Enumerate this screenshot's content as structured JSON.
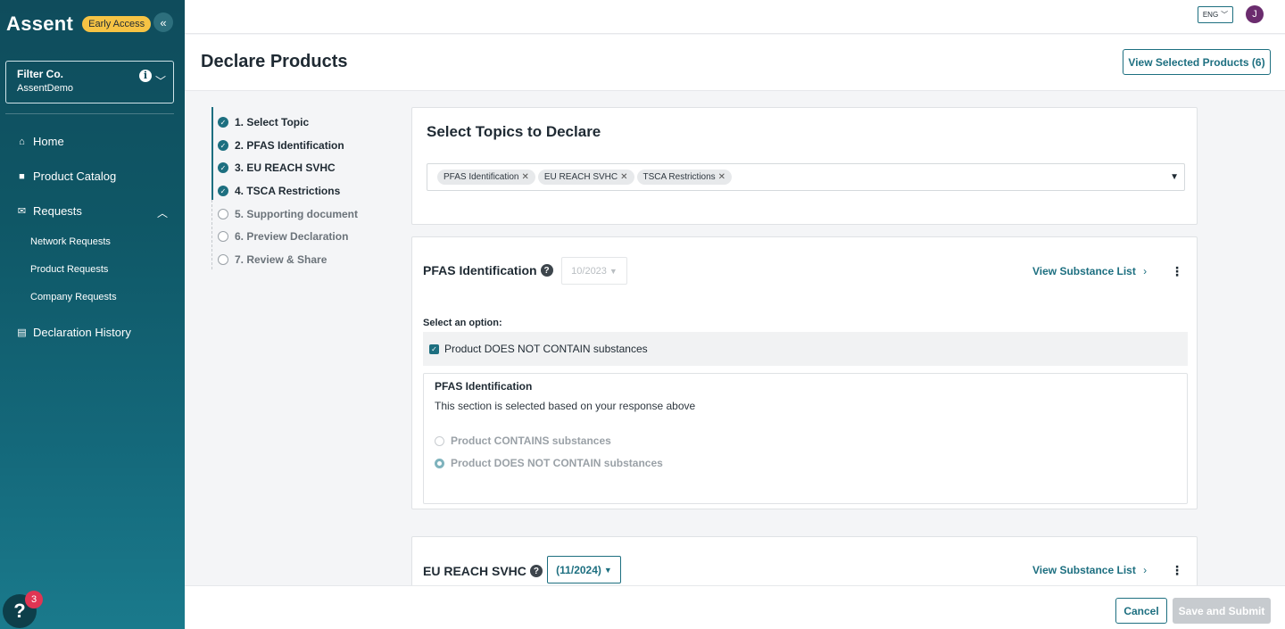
{
  "brand": {
    "name": "Assent",
    "badge": "Early Access",
    "collapse_icon": "double-chevron-left-icon"
  },
  "org": {
    "name": "Filter Co.",
    "sub": "AssentDemo"
  },
  "nav": {
    "home": "Home",
    "catalog": "Product Catalog",
    "requests": "Requests",
    "sub": [
      "Network Requests",
      "Product Requests",
      "Company Requests"
    ],
    "history": "Declaration History"
  },
  "help": {
    "label": "?",
    "count": "3"
  },
  "topbar": {
    "lang": "ENG",
    "avatar": "J"
  },
  "header": {
    "title": "Declare Products",
    "view_selected": "View Selected Products (6)"
  },
  "steps": [
    {
      "label": "1. Select Topic",
      "done": true
    },
    {
      "label": "2. PFAS Identification",
      "done": true
    },
    {
      "label": "3. EU REACH SVHC",
      "done": true
    },
    {
      "label": "4. TSCA Restrictions",
      "done": true
    },
    {
      "label": "5. Supporting document",
      "done": false
    },
    {
      "label": "6. Preview Declaration",
      "done": false
    },
    {
      "label": "7. Review & Share",
      "done": false
    }
  ],
  "topics": {
    "title": "Select Topics to Declare",
    "chips": [
      "PFAS Identification",
      "EU REACH SVHC",
      "TSCA Restrictions"
    ]
  },
  "pfas": {
    "title": "PFAS Identification",
    "version": "10/2023",
    "view_list": "View Substance List",
    "select_label": "Select an option:",
    "checkbox_label": "Product DOES NOT CONTAIN substances",
    "sub_title": "PFAS Identification",
    "sub_desc": "This section is selected based on your response above",
    "radio1": "Product CONTAINS substances",
    "radio2": "Product DOES NOT CONTAIN substances"
  },
  "reach": {
    "title": "EU REACH SVHC",
    "version": "(11/2024)",
    "view_list": "View Substance List"
  },
  "footer": {
    "cancel": "Cancel",
    "submit": "Save and Submit"
  },
  "colors": {
    "accent": "#1d6f80",
    "sidebar_top": "#0f4c5c",
    "badge": "#f6c344",
    "notify": "#e03553"
  }
}
